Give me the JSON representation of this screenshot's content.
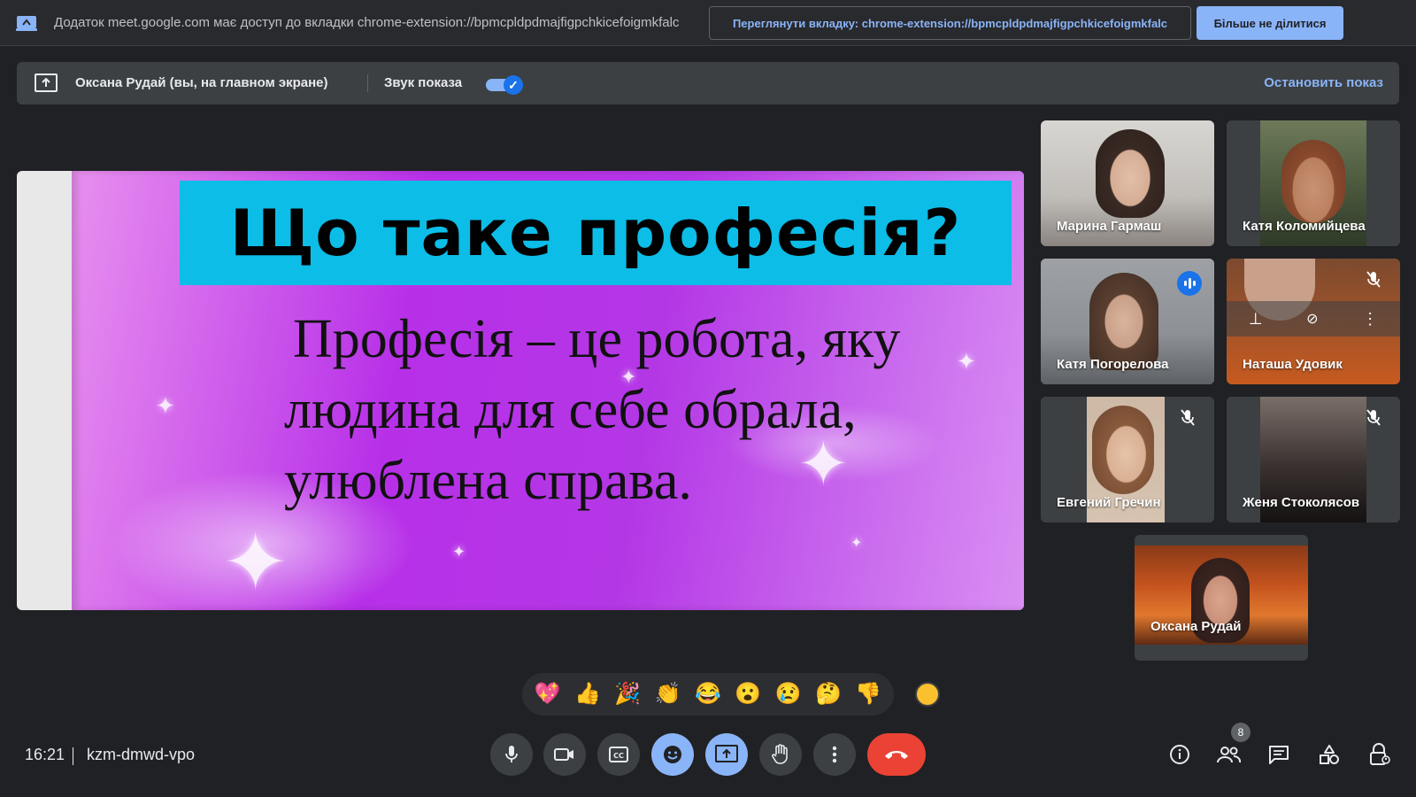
{
  "infobar": {
    "message": "Додаток meet.google.com має доступ до вкладки chrome-extension://bpmcpldpdmajfigpchkicefoigmkfalc",
    "view_tab_label": "Переглянути вкладку: chrome-extension://bpmcpldpdmajfigpchkicefoigmkfalc",
    "stop_sharing_label": "Більше не ділитися"
  },
  "present_bar": {
    "presenter_label": "Оксана Рудай (вы, на главном экране)",
    "audio_label": "Звук показа",
    "audio_enabled": true,
    "stop_label": "Остановить показ"
  },
  "slide": {
    "title": "Що таке професія?",
    "body_lines": [
      "Професія – це робота, яку",
      "людина для себе обрала,",
      "улюблена справа."
    ]
  },
  "participants": [
    {
      "name": "Марина Гармаш",
      "muted": false,
      "speaking": false
    },
    {
      "name": "Катя Коломийцева",
      "muted": false,
      "speaking": false
    },
    {
      "name": "Катя Погорелова",
      "muted": false,
      "speaking": true
    },
    {
      "name": "Наташа Удовик",
      "muted": true,
      "speaking": false
    },
    {
      "name": "Евгений Гречин",
      "muted": true,
      "speaking": false
    },
    {
      "name": "Женя Стоколясов",
      "muted": true,
      "speaking": false
    },
    {
      "name": "Оксана Рудай",
      "muted": false,
      "speaking": false
    }
  ],
  "reactions": [
    "💖",
    "👍",
    "🎉",
    "👏",
    "😂",
    "😮",
    "😢",
    "🤔",
    "👎"
  ],
  "bottom_bar": {
    "time": "16:21",
    "meeting_code": "kzm-dmwd-vpo",
    "participant_count": "8"
  },
  "colors": {
    "background": "#202124",
    "accent": "#8ab4f8",
    "hangup": "#ea4335",
    "title_box": "#0cbde7"
  }
}
